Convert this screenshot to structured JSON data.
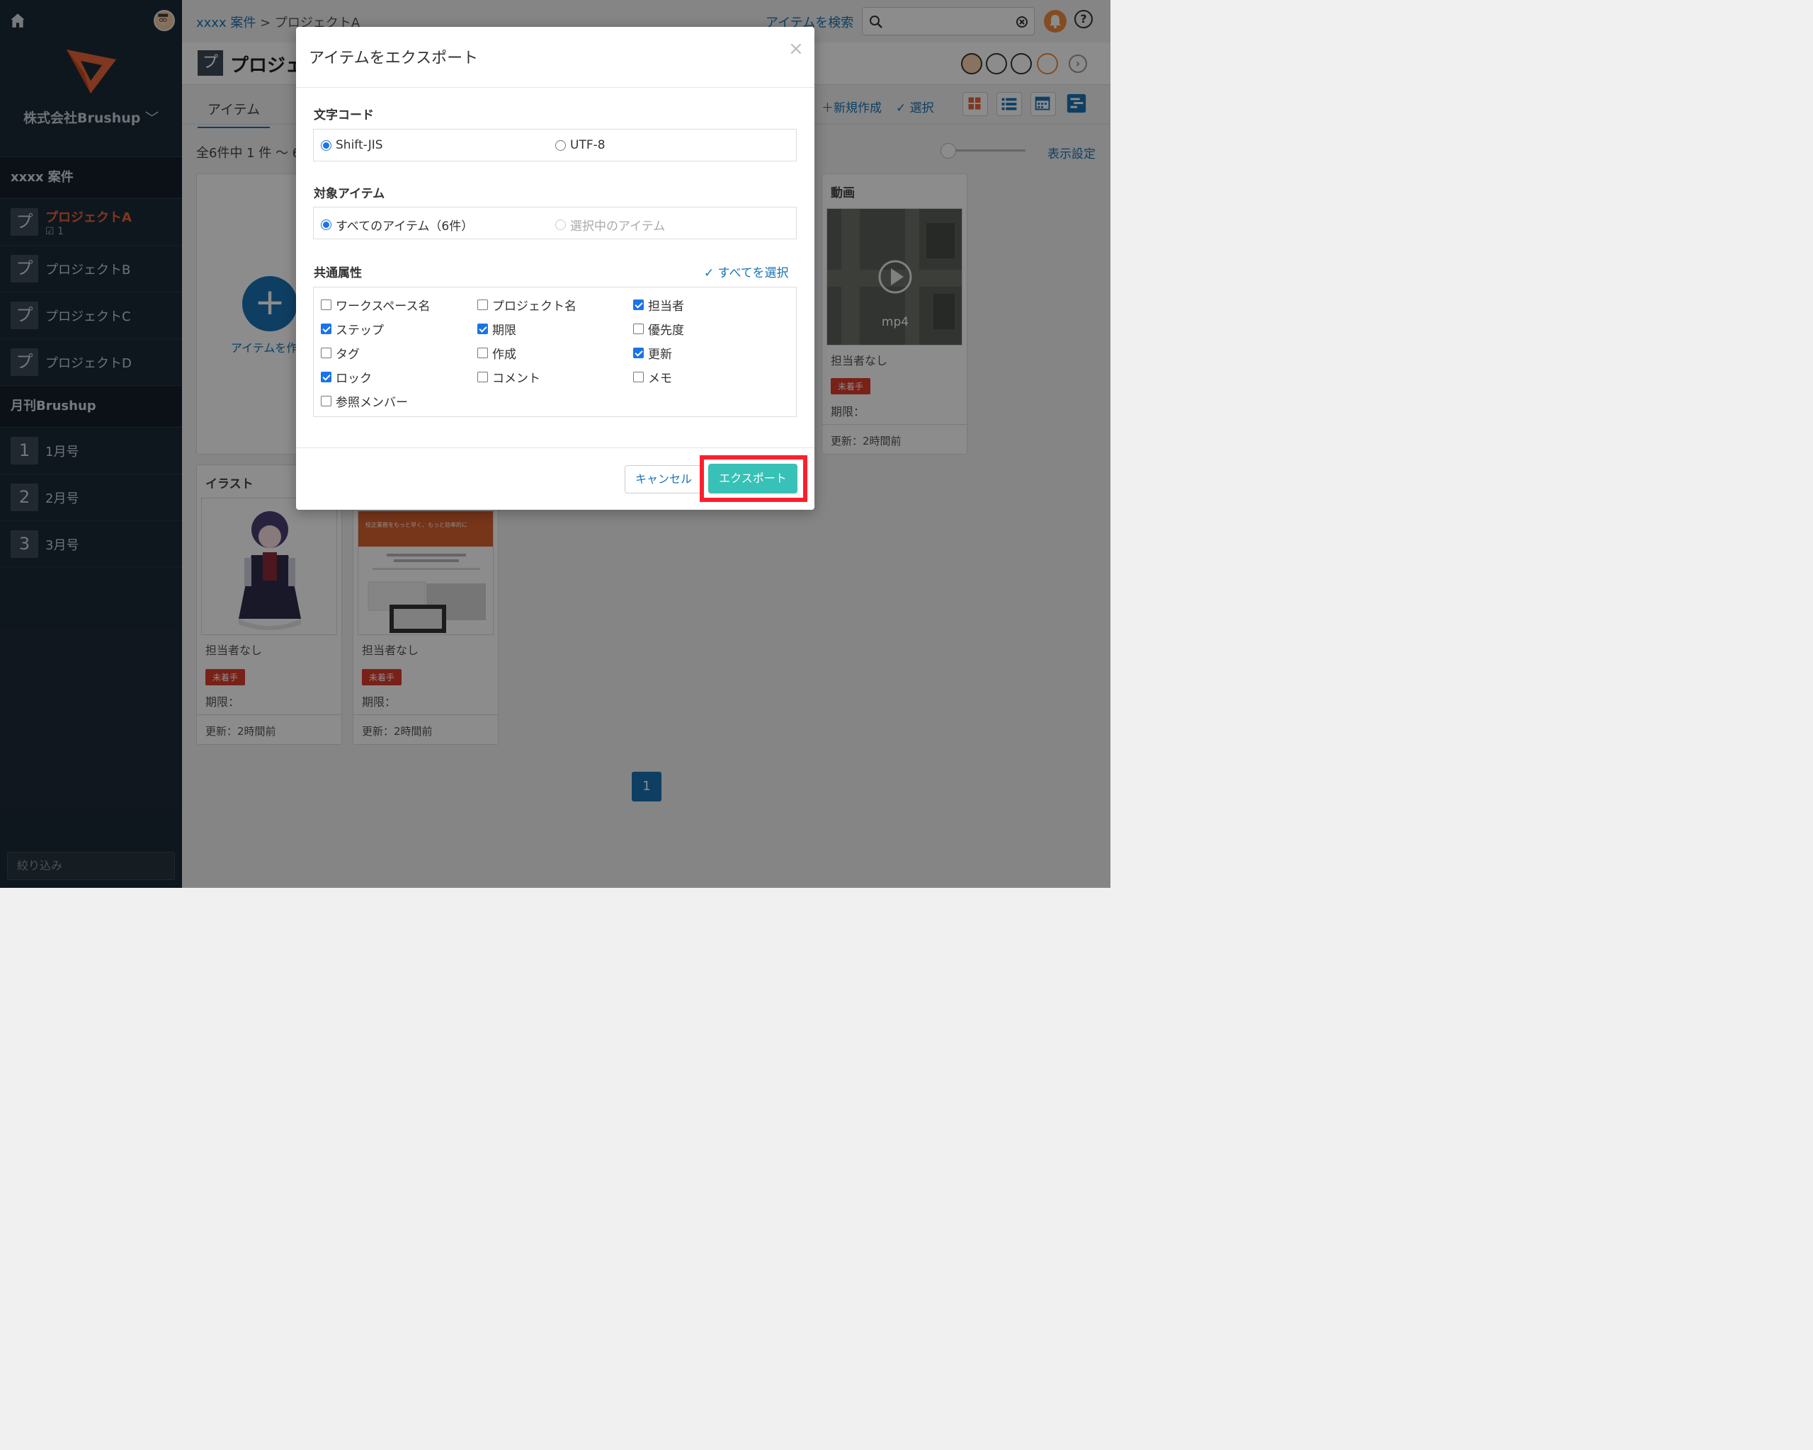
{
  "sidebar": {
    "company": "株式会社Brushup",
    "groups": [
      {
        "label": "xxxx 案件"
      },
      {
        "label": "月刊Brushup"
      }
    ],
    "projects": [
      {
        "badge": "プ",
        "label": "プロジェクトA",
        "sub": "1"
      },
      {
        "badge": "プ",
        "label": "プロジェクトB"
      },
      {
        "badge": "プ",
        "label": "プロジェクトC"
      },
      {
        "badge": "プ",
        "label": "プロジェクトD"
      }
    ],
    "issues": [
      {
        "badge": "1",
        "label": "1月号"
      },
      {
        "badge": "2",
        "label": "2月号"
      },
      {
        "badge": "3",
        "label": "3月号"
      }
    ],
    "filter_placeholder": "絞り込み"
  },
  "header": {
    "breadcrumb_link": "xxxx 案件",
    "breadcrumb_sep": " > ",
    "breadcrumb_current": "プロジェクトA",
    "search_link": "アイテムを検索",
    "help": "?"
  },
  "titlebar": {
    "badge": "プ",
    "title": "プロジェクトA"
  },
  "tabs": {
    "active": "アイテム"
  },
  "toolbar": {
    "new_label": "新規作成",
    "select_label": "選択",
    "display_settings": "表示設定"
  },
  "listing": {
    "count_text": "全6件中 1 件 〜 6 件"
  },
  "create": {
    "label": "アイテムを作成"
  },
  "cards": [
    {
      "category": "動画",
      "thumb_label": "mp4",
      "owner": "担当者なし",
      "status": "未着手",
      "deadline": "期限：",
      "updated": "更新：2時間前"
    },
    {
      "category": "イラスト",
      "owner": "担当者なし",
      "status": "未着手",
      "deadline": "期限：",
      "updated": "更新：2時間前"
    },
    {
      "category": "",
      "thumb_text": "校正業務をもっと早く、もっと効率的に",
      "owner": "担当者なし",
      "status": "未着手",
      "deadline": "期限：",
      "updated": "更新：2時間前"
    }
  ],
  "pagination": {
    "current": "1"
  },
  "modal": {
    "title": "アイテムをエクスポート",
    "close": "×",
    "encoding_label": "文字コード",
    "encoding_options": [
      {
        "label": "Shift-JIS",
        "selected": true
      },
      {
        "label": "UTF-8",
        "selected": false
      }
    ],
    "target_label": "対象アイテム",
    "target_options": [
      {
        "label": "すべてのアイテム（6件）",
        "selected": true
      },
      {
        "label": "選択中のアイテム",
        "selected": false,
        "disabled": true
      }
    ],
    "attrs_label": "共通属性",
    "select_all": "すべてを選択",
    "attributes": [
      {
        "label": "ワークスペース名",
        "checked": false
      },
      {
        "label": "プロジェクト名",
        "checked": false
      },
      {
        "label": "担当者",
        "checked": true
      },
      {
        "label": "ステップ",
        "checked": true
      },
      {
        "label": "期限",
        "checked": true
      },
      {
        "label": "優先度",
        "checked": false
      },
      {
        "label": "タグ",
        "checked": false
      },
      {
        "label": "作成",
        "checked": false
      },
      {
        "label": "更新",
        "checked": true
      },
      {
        "label": "ロック",
        "checked": true
      },
      {
        "label": "コメント",
        "checked": false
      },
      {
        "label": "メモ",
        "checked": false
      },
      {
        "label": "参照メンバー",
        "checked": false
      }
    ],
    "cancel": "キャンセル",
    "export": "エクスポート"
  },
  "colors": {
    "accent": "#1a73b5",
    "export_button": "#38c1b6",
    "highlight": "#ff1f2c",
    "status": "#dd3b2a",
    "active_project": "#e8643a"
  }
}
